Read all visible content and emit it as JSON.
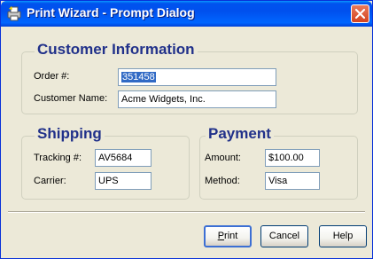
{
  "window": {
    "title": "Print Wizard - Prompt Dialog",
    "app_icon": "print-wizard-icon",
    "close_icon": "close-icon"
  },
  "customer": {
    "legend": "Customer Information",
    "order_label": "Order #:",
    "order_value": "351458",
    "name_label": "Customer Name:",
    "name_value": "Acme Widgets, Inc."
  },
  "shipping": {
    "legend": "Shipping",
    "tracking_label": "Tracking #:",
    "tracking_value": "AV5684",
    "carrier_label": "Carrier:",
    "carrier_value": "UPS"
  },
  "payment": {
    "legend": "Payment",
    "amount_label": "Amount:",
    "amount_value": "$100.00",
    "method_label": "Method:",
    "method_value": "Visa"
  },
  "buttons": {
    "print_mnemonic": "P",
    "print_rest": "rint",
    "cancel": "Cancel",
    "help": "Help"
  },
  "colors": {
    "title_bar": "#0053ee",
    "legend_text": "#21318a",
    "selection": "#316ac5",
    "close_button": "#d4431f"
  }
}
